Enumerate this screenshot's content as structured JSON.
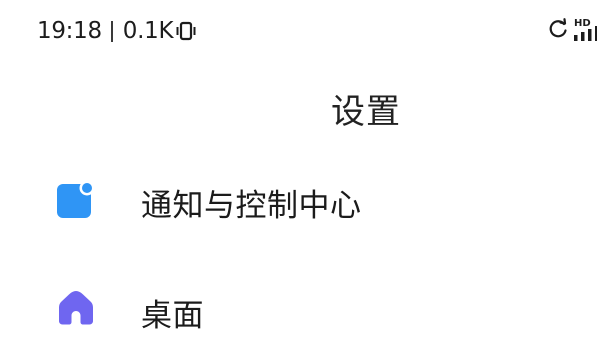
{
  "status_bar": {
    "time": "19:18",
    "network_speed": "0.1K",
    "vibrate_icon": "vibrate-icon",
    "sync_icon": "sync-icon",
    "signal_icon": "signal-hd-icon",
    "hd_label": "HD"
  },
  "header": {
    "title": "设置"
  },
  "settings": {
    "items": [
      {
        "label": "通知与控制中心",
        "icon": "notification-icon",
        "icon_color": "#2f95f5"
      },
      {
        "label": "桌面",
        "icon": "home-icon",
        "icon_color": "#6f66f0"
      }
    ]
  }
}
